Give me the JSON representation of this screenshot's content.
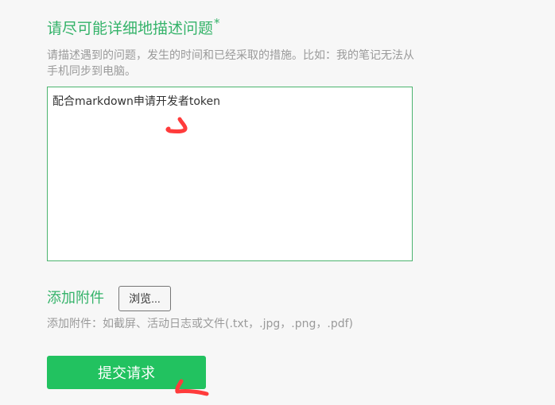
{
  "description_field": {
    "title": "请尽可能详细地描述问题",
    "required_mark": "*",
    "hint": "请描述遇到的问题，发生的时间和已经采取的措施。比如：我的笔记无法从手机同步到电脑。",
    "value": "配合markdown申请开发者token"
  },
  "attachment": {
    "label": "添加附件",
    "browse_button": "浏览...",
    "hint": "添加附件：如截屏、活动日志或文件(.txt，.jpg，.png，.pdf)"
  },
  "submit_button": "提交请求",
  "colors": {
    "accent_green": "#35b36a",
    "submit_green": "#22c260",
    "annotation_red": "#ff3b3b",
    "hint_gray": "#9a9a9a"
  }
}
